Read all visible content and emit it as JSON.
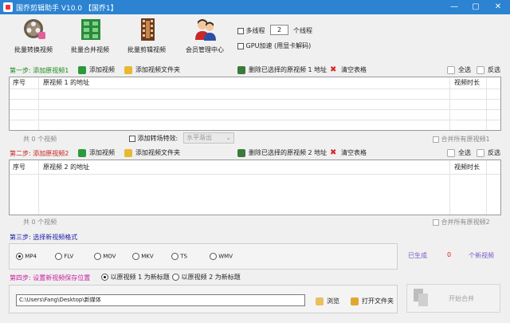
{
  "window": {
    "title": "国乔剪辑助手 V10.0  【国乔1】"
  },
  "toolbar": [
    {
      "label": "批量转换视频",
      "icon": "film-reel-icon"
    },
    {
      "label": "批量合并视频",
      "icon": "merge-grid-icon"
    },
    {
      "label": "批量剪辑视频",
      "icon": "film-clip-icon"
    },
    {
      "label": "会员管理中心",
      "icon": "members-icon"
    }
  ],
  "options": {
    "multithread_label": "多线程",
    "thread_count": "2",
    "thread_unit": "个线程",
    "gpu_label": "GPU加速 (用显卡解码)"
  },
  "step1": {
    "title": "第一步: 添加原视频1",
    "add_video": "添加视频",
    "add_folder": "添加视频文件夹",
    "delete_selected": "删除已选择的原视频 1 地址",
    "clear_table": "清空表格",
    "select_all": "全选",
    "invert": "反选",
    "col_index": "序号",
    "col_path": "原视频 1 的地址",
    "col_duration": "视频时长",
    "count_text": "共 0 个视频",
    "merge_all_label": "合并所有原视频1"
  },
  "transition": {
    "label": "添加转场特效:",
    "value": "水平渐出"
  },
  "step2": {
    "title": "第二步: 添加原视频2",
    "add_video": "添加视频",
    "add_folder": "添加视频文件夹",
    "delete_selected": "删除已选择的原视频 2 地址",
    "clear_table": "清空表格",
    "select_all": "全选",
    "invert": "反选",
    "col_index": "序号",
    "col_path": "原视频 2 的地址",
    "col_duration": "视频时长",
    "count_text": "共 0 个视频",
    "merge_all_label": "合并所有原视频2"
  },
  "step3": {
    "title": "第三步: 选择新视频格式",
    "formats": [
      "MP4",
      "FLV",
      "MOV",
      "MKV",
      "TS",
      "WMV"
    ],
    "selected": "MP4",
    "generated_label": "已生成",
    "generated_count": "0",
    "generated_unit": "个新视频"
  },
  "step4": {
    "title": "第四步: 设置新视频保存位置",
    "option1": "以原视频 1 为新标题",
    "option2": "以原视频 2 为新标题",
    "path": "C:\\Users\\Fang\\Desktop\\新媒体",
    "browse": "浏览",
    "open_folder": "打开文件夹",
    "start_merge": "开始合并"
  },
  "colors": {
    "titlebar": "#2b83d1",
    "step1_title": "#1a8a1a",
    "step2_title": "#c81e1e",
    "step3_title": "#1a1aa8",
    "step4_title": "#c81e9e",
    "generated": "#7b59c8",
    "count": "#e02020"
  }
}
